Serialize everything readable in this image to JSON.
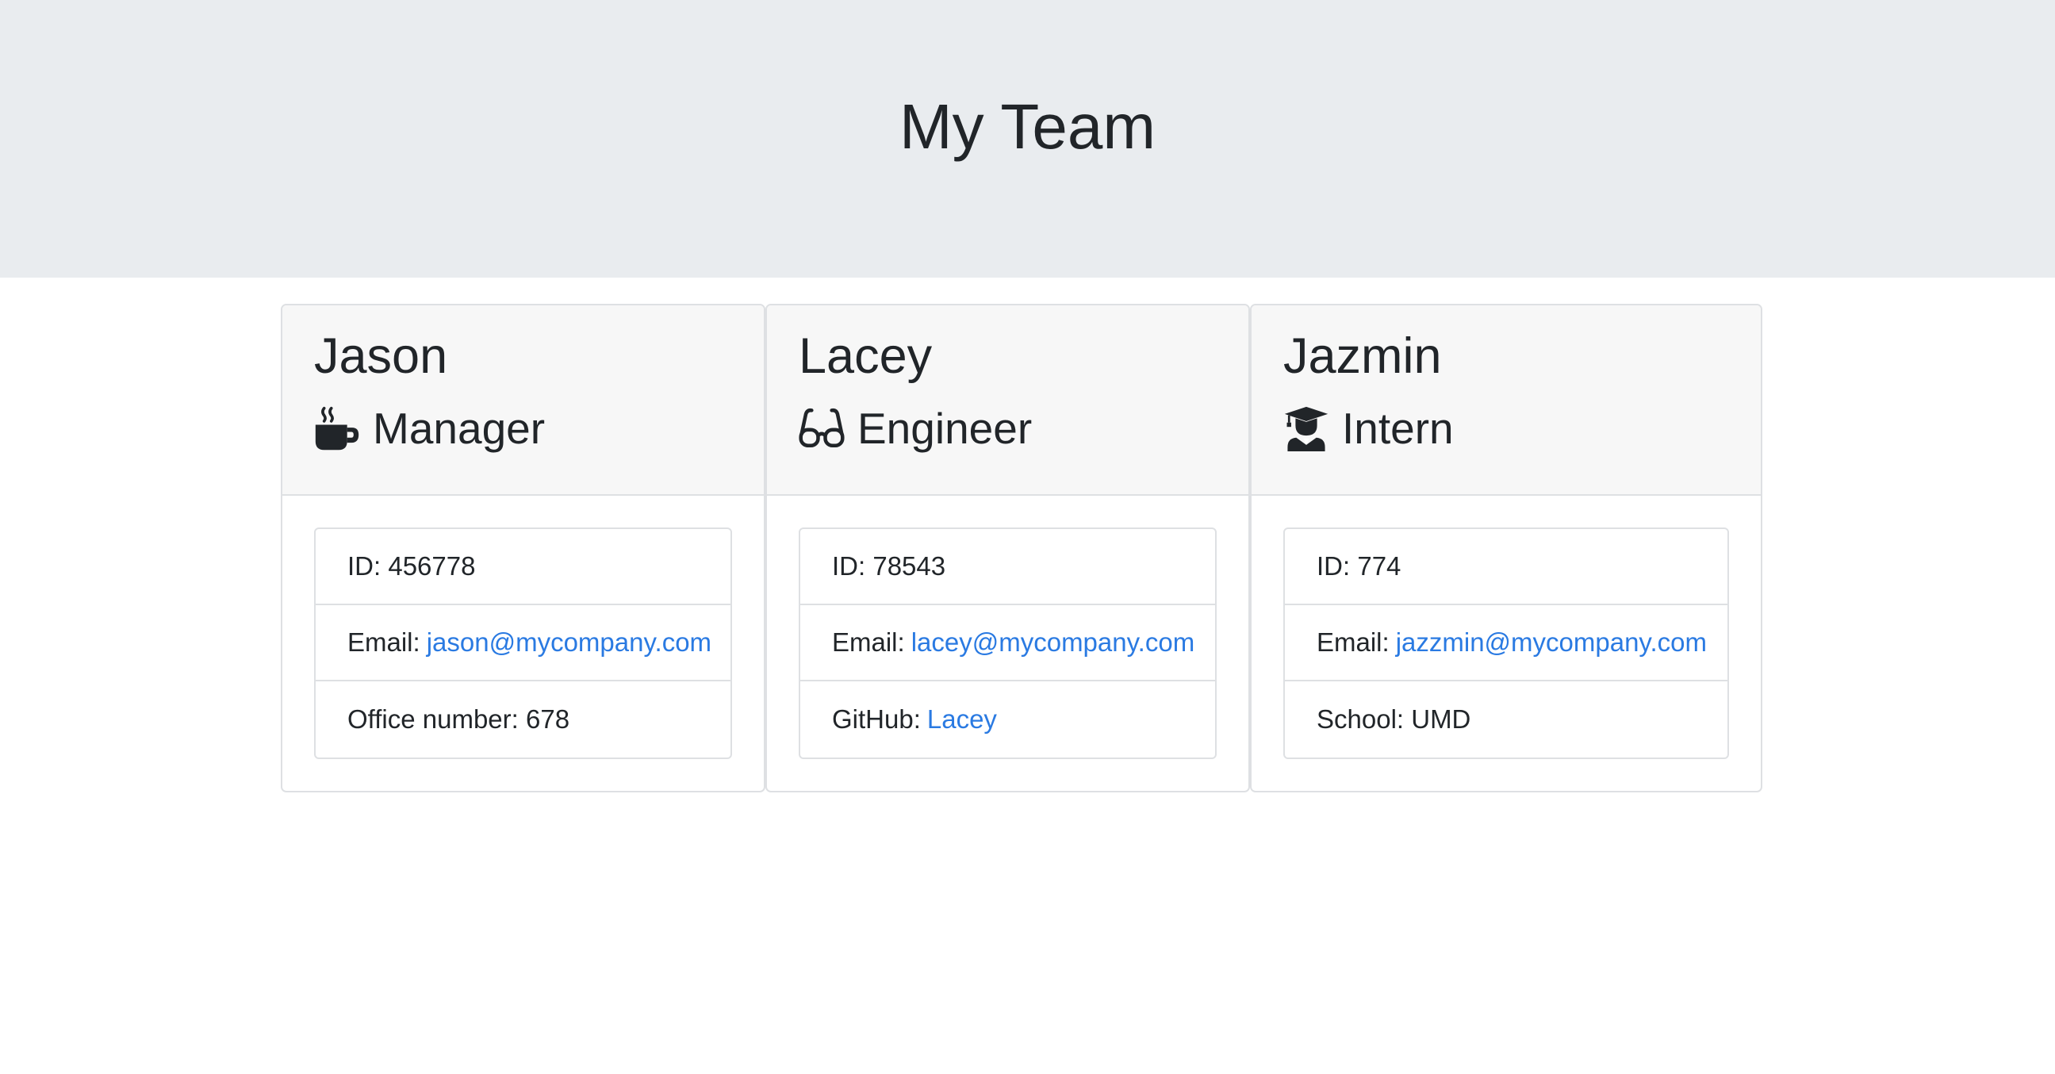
{
  "header": {
    "title": "My Team"
  },
  "cards": [
    {
      "name": "Jason",
      "role": "Manager",
      "icon": "coffee-mug-icon",
      "id_label": "ID: 456778",
      "email_prefix": "Email:",
      "email": "jason@mycompany.com",
      "extra_prefix": "Office number: 678",
      "extra_link": ""
    },
    {
      "name": "Lacey",
      "role": "Engineer",
      "icon": "glasses-icon",
      "id_label": "ID: 78543",
      "email_prefix": "Email:",
      "email": "lacey@mycompany.com",
      "extra_prefix": "GitHub:",
      "extra_link": "Lacey"
    },
    {
      "name": "Jazmin",
      "role": "Intern",
      "icon": "graduate-icon",
      "id_label": "ID: 774",
      "email_prefix": "Email:",
      "email": "jazzmin@mycompany.com",
      "extra_prefix": "School: UMD",
      "extra_link": ""
    }
  ],
  "colors": {
    "link": "#2a7ae2",
    "jumbotron": "#e9ecef",
    "card_header": "#f7f7f7"
  }
}
